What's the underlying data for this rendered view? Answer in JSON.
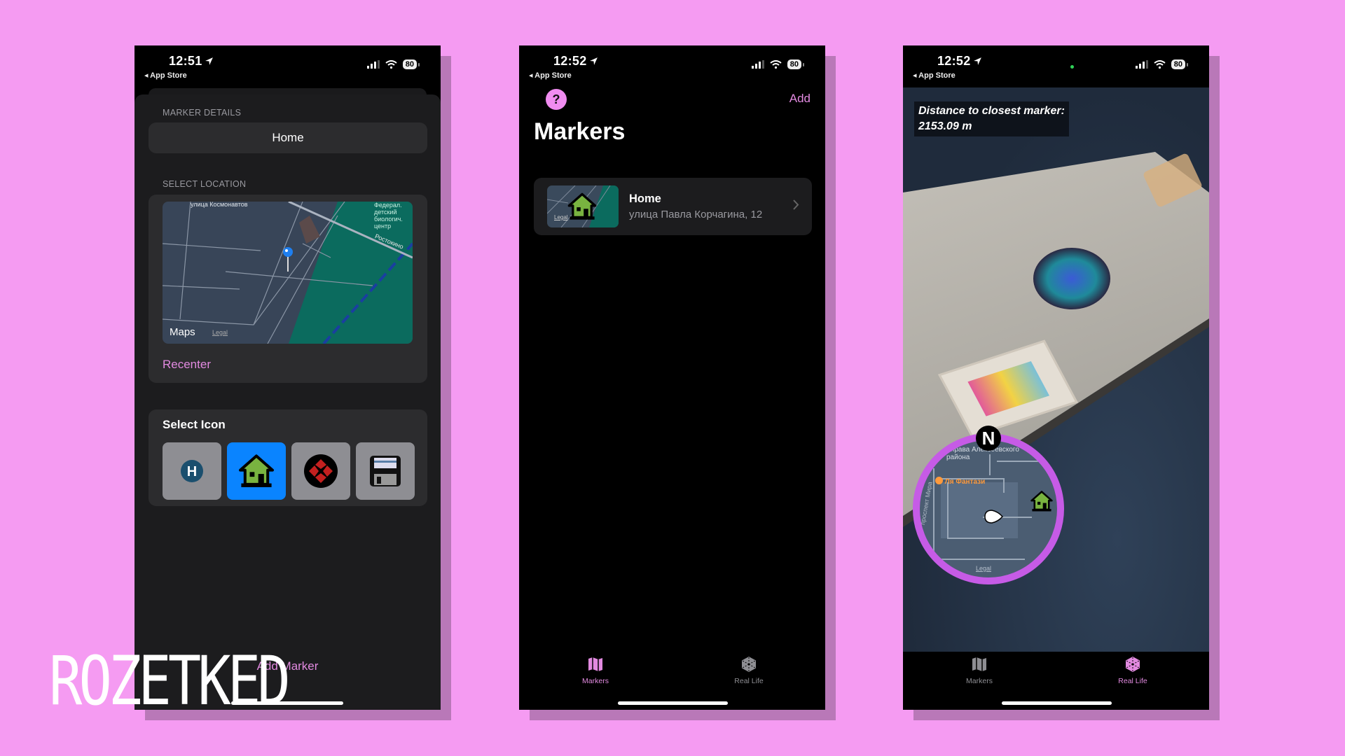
{
  "colors": {
    "background": "#f59bf2",
    "accent": "#e28ae0",
    "selected_icon": "#0a84ff",
    "minimap_ring": "#c65be6"
  },
  "screens": [
    {
      "status": {
        "time": "12:51",
        "back": "App Store",
        "battery": "80"
      },
      "marker_details_label": "MARKER DETAILS",
      "name_value": "Home",
      "select_location_label": "SELECT LOCATION",
      "map": {
        "street_1": "улица Космонавтов",
        "street_2": "Ростокино",
        "poi": "Федерал. детский биологич. центр",
        "brand": "Maps",
        "legal": "Legal"
      },
      "recenter": "Recenter",
      "select_icon_title": "Select Icon",
      "icons": [
        {
          "name": "hospital-icon",
          "selected": false
        },
        {
          "name": "house-icon",
          "selected": true
        },
        {
          "name": "target-icon",
          "selected": false
        },
        {
          "name": "floppy-disk-icon",
          "selected": false
        }
      ],
      "add_marker": "Add Marker"
    },
    {
      "status": {
        "time": "12:52",
        "back": "App Store",
        "battery": "80"
      },
      "help": "?",
      "add": "Add",
      "title": "Markers",
      "markers": [
        {
          "title": "Home",
          "address": "улица Павла Корчагина, 12",
          "thumb_legal": "Legal"
        }
      ],
      "tabs": [
        {
          "label": "Markers",
          "active": true
        },
        {
          "label": "Real Life",
          "active": false
        }
      ]
    },
    {
      "status": {
        "time": "12:52",
        "back": "App Store",
        "battery": "80"
      },
      "distance_line1": "Distance to closest marker:",
      "distance_line2": "2153.09 m",
      "minimap": {
        "north": "N",
        "poi_1": "Управа Алексеевского района",
        "poi_2": "Ля Фантази",
        "street": "проспект Мира",
        "legal": "Legal"
      },
      "tabs": [
        {
          "label": "Markers",
          "active": false
        },
        {
          "label": "Real Life",
          "active": true
        }
      ]
    }
  ],
  "watermark": "ROZETKED"
}
